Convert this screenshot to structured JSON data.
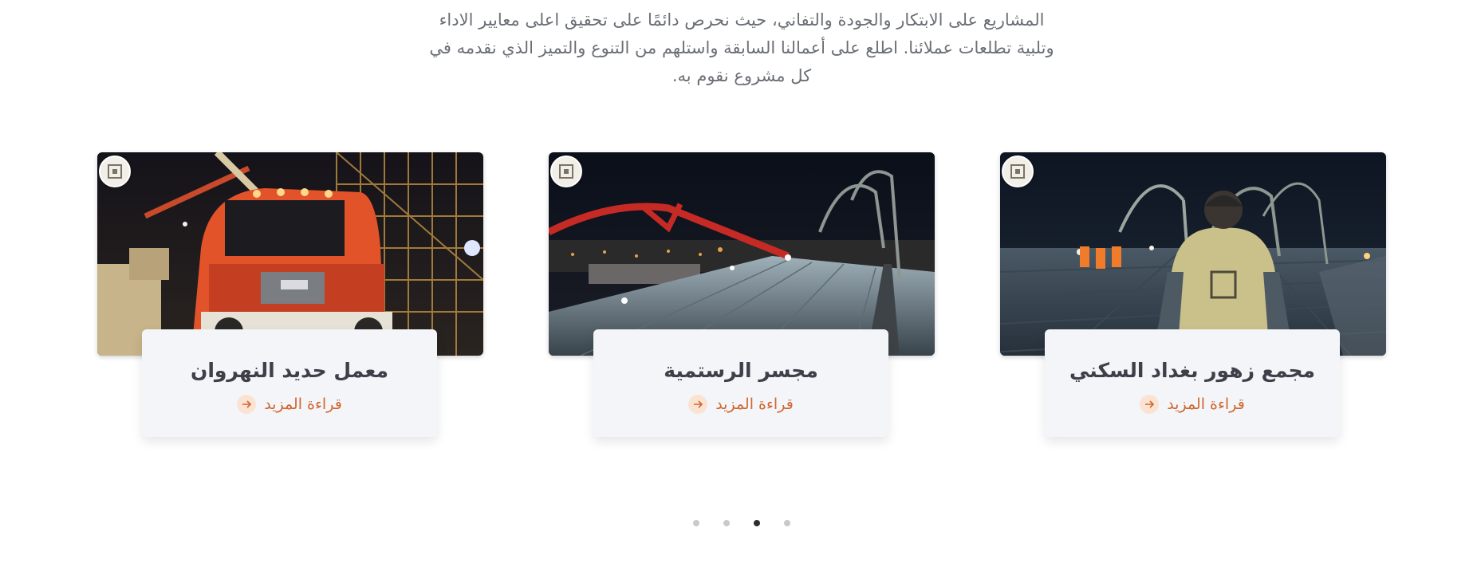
{
  "intro": {
    "lines": [
      "المشاريع على الابتكار والجودة والتفاني، حيث نحرص دائمًا على تحقيق اعلى معايير الاداء",
      "وتلبية تطلعات عملائنا. اطلع على أعمالنا السابقة واستلهم من التنوع والتميز الذي نقدمه في",
      "كل مشروع نقوم به."
    ]
  },
  "projects": [
    {
      "title": "مجمع زهور بغداد السكني",
      "link_label": "قراءة المزيد",
      "image": "construction-worker-night-site"
    },
    {
      "title": "مجسر الرستمية",
      "link_label": "قراءة المزيد",
      "image": "concrete-pump-bridge-deck"
    },
    {
      "title": "معمل حديد النهروان",
      "link_label": "قراءة المزيد",
      "image": "orange-truck-steel-factory"
    }
  ],
  "carousel": {
    "pages": 4,
    "active_index": 2
  },
  "colors": {
    "accent": "#d0652d",
    "title": "#3d4049",
    "text": "#6b6f76",
    "card_bg": "#f4f5f8"
  },
  "icons": {
    "arrow": "arrow-icon",
    "logo": "company-logo-icon"
  }
}
